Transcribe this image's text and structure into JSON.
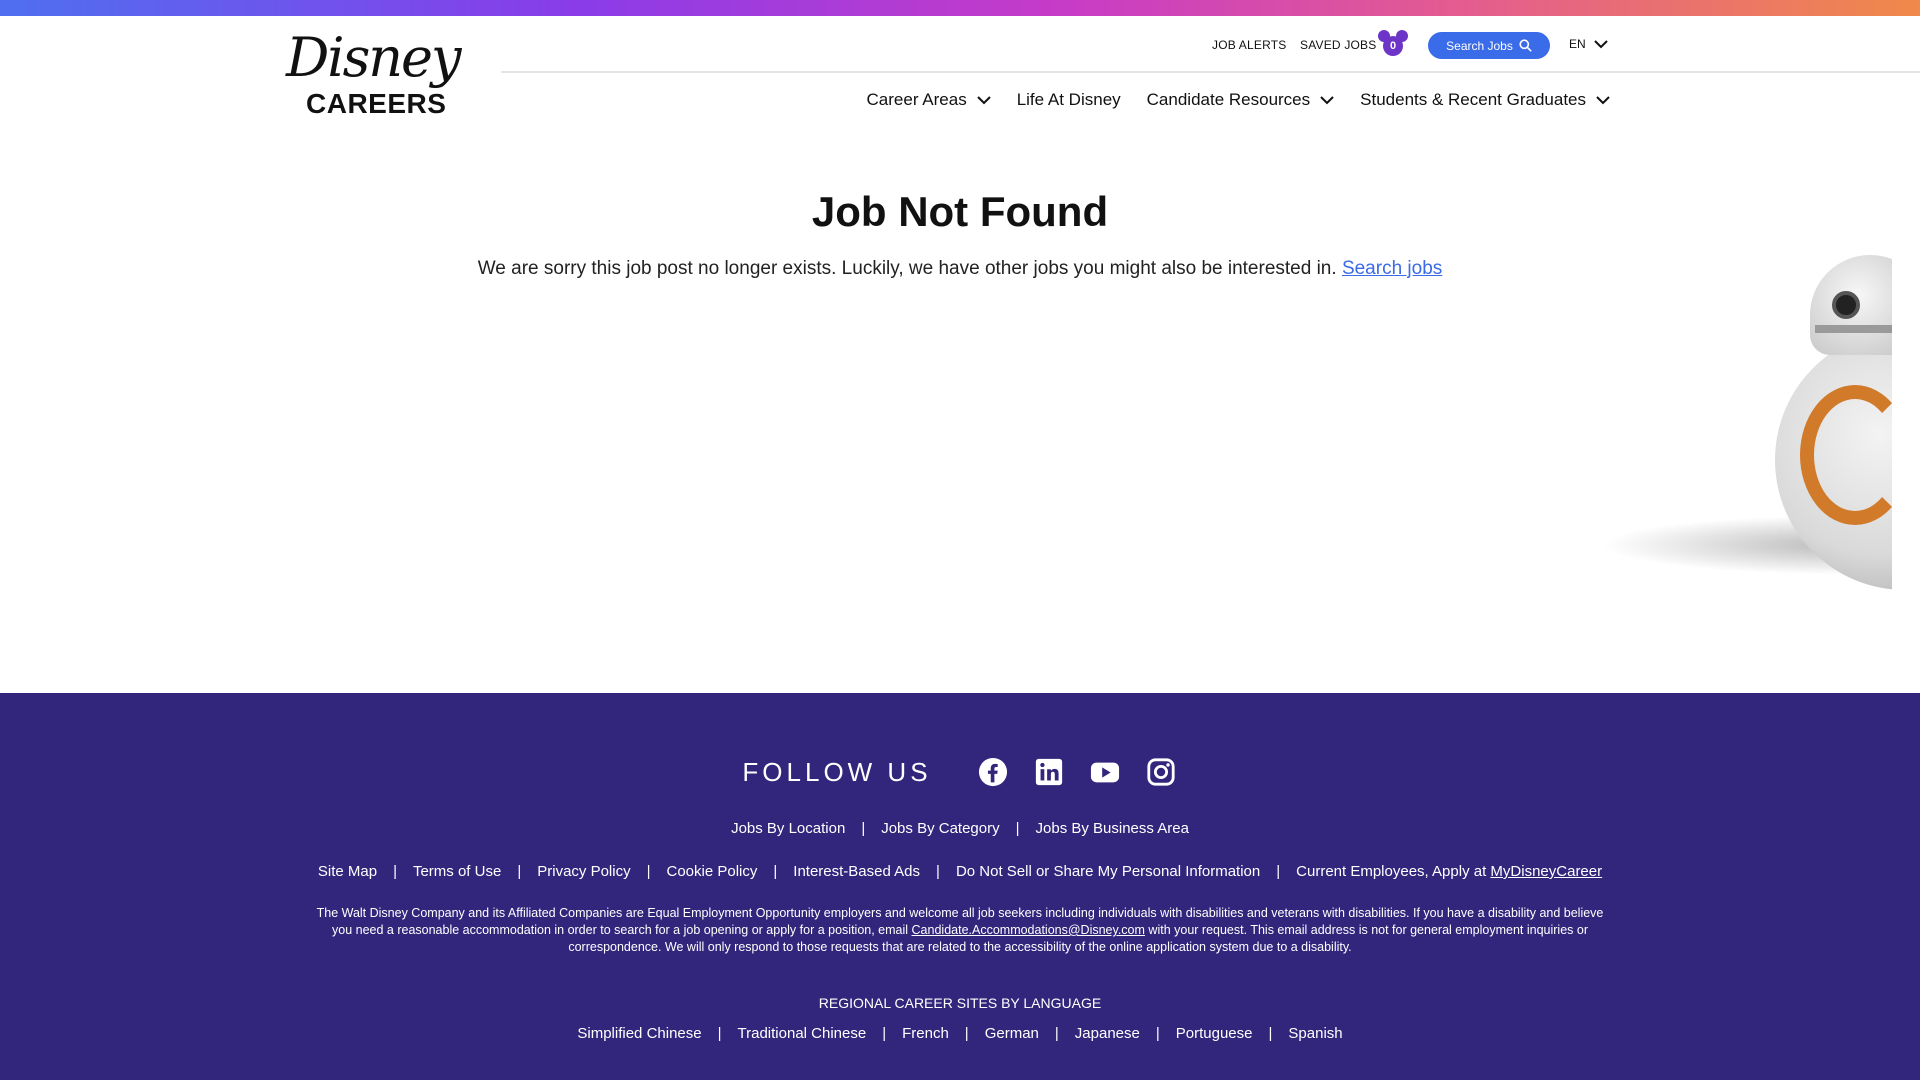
{
  "header": {
    "logo_text": "Disney",
    "logo_sub": "CAREERS",
    "job_alerts": "JOB ALERTS",
    "saved_jobs": "SAVED JOBS",
    "saved_count": "0",
    "search_button": "Search Jobs",
    "language": "EN"
  },
  "nav": {
    "items": [
      {
        "label": "Career Areas",
        "dropdown": true
      },
      {
        "label": "Life At Disney",
        "dropdown": false
      },
      {
        "label": "Candidate Resources",
        "dropdown": true
      },
      {
        "label": "Students & Recent Graduates",
        "dropdown": true
      }
    ]
  },
  "main": {
    "title": "Job Not Found",
    "message": "We are sorry this job post no longer exists. Luckily, we have other jobs you might also be interested in.",
    "search_link": "Search jobs"
  },
  "footer": {
    "follow_us": "FOLLOW US",
    "social": [
      "facebook-icon",
      "linkedin-icon",
      "youtube-icon",
      "instagram-icon"
    ],
    "jobs_links": [
      "Jobs By Location",
      "Jobs By Category",
      "Jobs By Business Area"
    ],
    "legal_links": [
      "Site Map",
      "Terms of Use",
      "Privacy Policy",
      "Cookie Policy",
      "Interest-Based Ads",
      "Do Not Sell or Share My Personal Information"
    ],
    "current_employees": "Current Employees, Apply at",
    "mydisneycareer": "MyDisneyCareer",
    "disclaimer_1": "The Walt Disney Company and its Affiliated Companies are Equal Employment Opportunity employers and welcome all job seekers including individuals with disabilities and veterans with disabilities. If you have a disability and believe you need a reasonable accommodation in order to search for a job opening or apply for a position, email",
    "disclaimer_email": "Candidate.Accommodations@Disney.com",
    "disclaimer_2": "with your request. This email address is not for general employment inquiries or correspondence. We will only respond to those requests that are related to the accessibility of the online application system due to a disability.",
    "regional_title": "REGIONAL CAREER SITES BY LANGUAGE",
    "languages": [
      "Simplified Chinese",
      "Traditional Chinese",
      "French",
      "German",
      "Japanese",
      "Portuguese",
      "Spanish"
    ]
  },
  "colors": {
    "accent": "#3a6be8",
    "footer_bg": "#32257c",
    "mickey": "#6c35c8"
  }
}
